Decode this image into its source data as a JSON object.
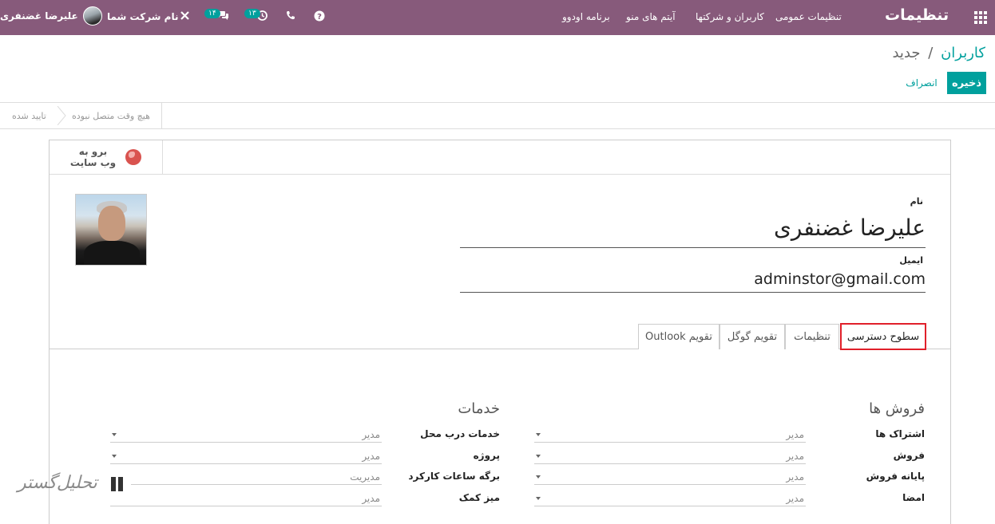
{
  "navbar": {
    "brand": "تنظیمات",
    "menu": [
      "تنظیمات عمومی",
      "کاربران و شرکتها",
      "آیتم های منو",
      "برنامه اودوو"
    ],
    "user_name": "علیرضا غضنفری",
    "company": "نام شرکت شما",
    "messages_badge": "۱۴",
    "activities_badge": "۱۳"
  },
  "control": {
    "breadcrumb_parent": "کاربران",
    "breadcrumb_sep": "/",
    "breadcrumb_current": "جدید",
    "save_label": "ذخیره",
    "discard_label": "انصراف"
  },
  "status": {
    "stage_confirmed": "تایید شده",
    "stage_never_connected": "هیچ وقت متصل نبوده"
  },
  "sheet": {
    "website_line1": "برو به",
    "website_line2": "وب سایت",
    "name_label": "نام",
    "name_value": "علیرضا غضنفری",
    "email_label": "ایمیل",
    "email_value": "adminstor@gmail.com"
  },
  "tabs": [
    "سطوح دسترسی",
    "تنظیمات",
    "تقویم گوگل",
    "تقویم Outlook"
  ],
  "access": {
    "sales": {
      "title": "فروش ها",
      "rows": [
        {
          "label": "اشتراک ها",
          "value": "مدیر"
        },
        {
          "label": "فروش",
          "value": "مدیر"
        },
        {
          "label": "پایانه فروش",
          "value": "مدیر"
        },
        {
          "label": "امضا",
          "value": "مدیر"
        }
      ]
    },
    "services": {
      "title": "خدمات",
      "rows": [
        {
          "label": "خدمات درب محل",
          "value": "مدیر"
        },
        {
          "label": "پروژه",
          "value": "مدیر"
        },
        {
          "label": "برگه ساعات کارکرد",
          "value": "مدیریت"
        },
        {
          "label": "میز کمک",
          "value": "مدیر"
        }
      ]
    }
  },
  "watermark": "تحلیل‌گستر",
  "colors": {
    "navbar": "#875a7b",
    "primary": "#00a09d",
    "highlight": "#e0202a"
  }
}
